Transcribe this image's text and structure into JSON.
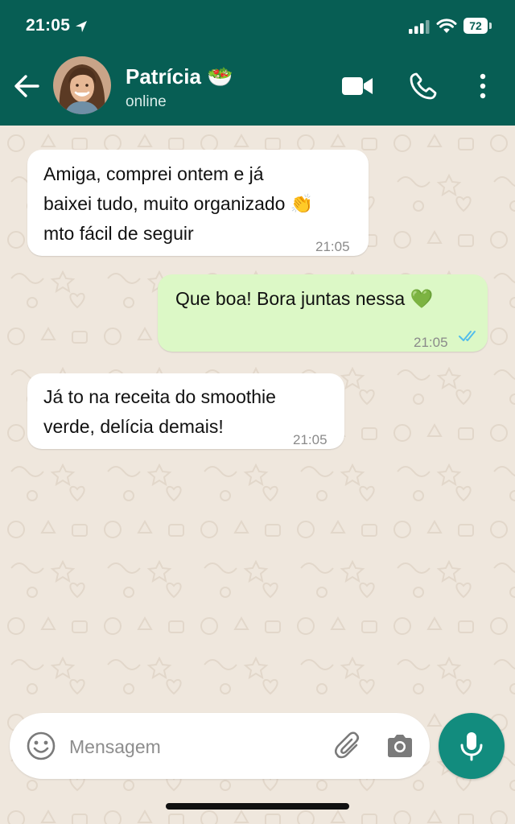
{
  "status_bar": {
    "time": "21:05",
    "battery": "72"
  },
  "contact": {
    "name": "Patrícia 🥗",
    "status": "online"
  },
  "messages": [
    {
      "direction": "incoming",
      "text": "Amiga, comprei ontem e já\nbaixei tudo, muito organizado 👏\nmto fácil de seguir",
      "time": "21:05"
    },
    {
      "direction": "outgoing",
      "text": "Que boa! Bora juntas nessa 💚",
      "time": "21:05",
      "read": true
    },
    {
      "direction": "incoming",
      "text": "Já to na receita do smoothie\nverde, delícia demais!",
      "time": "21:05"
    }
  ],
  "composer": {
    "placeholder": "Mensagem"
  },
  "icons": {
    "back": "arrow-left-icon",
    "video": "video-camera-icon",
    "call": "phone-icon",
    "menu": "more-vertical-icon",
    "emoji": "smiley-icon",
    "attach": "paperclip-icon",
    "camera": "camera-icon",
    "mic": "microphone-icon"
  },
  "colors": {
    "header": "#075e54",
    "chat_background": "#efe7dd",
    "outgoing_bubble": "#dcf8c6",
    "incoming_bubble": "#ffffff",
    "accent": "#128c7e",
    "read_ticks": "#53bdeb"
  }
}
